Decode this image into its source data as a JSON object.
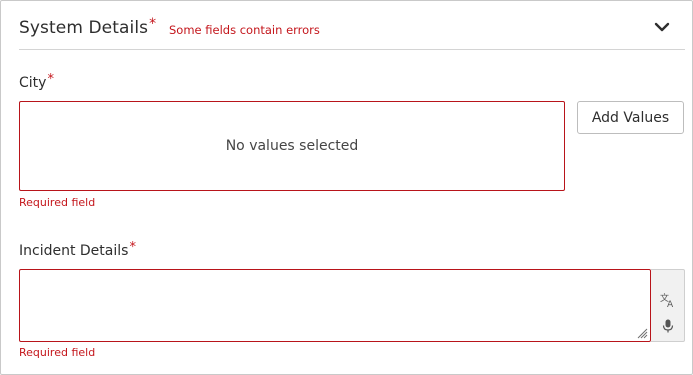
{
  "section": {
    "title": "System Details",
    "required_marker": "*",
    "error_message": "Some fields contain errors",
    "collapse_icon": "chevron-down-icon"
  },
  "city": {
    "label": "City",
    "required_marker": "*",
    "empty_text": "No values selected",
    "add_button_label": "Add Values",
    "error": "Required field"
  },
  "incident": {
    "label": "Incident Details",
    "required_marker": "*",
    "value": "",
    "error": "Required field",
    "tools": [
      "translate-icon",
      "microphone-icon"
    ]
  },
  "colors": {
    "error": "#c4161c",
    "border": "#c9c9c9",
    "text": "#2e2e2e"
  }
}
